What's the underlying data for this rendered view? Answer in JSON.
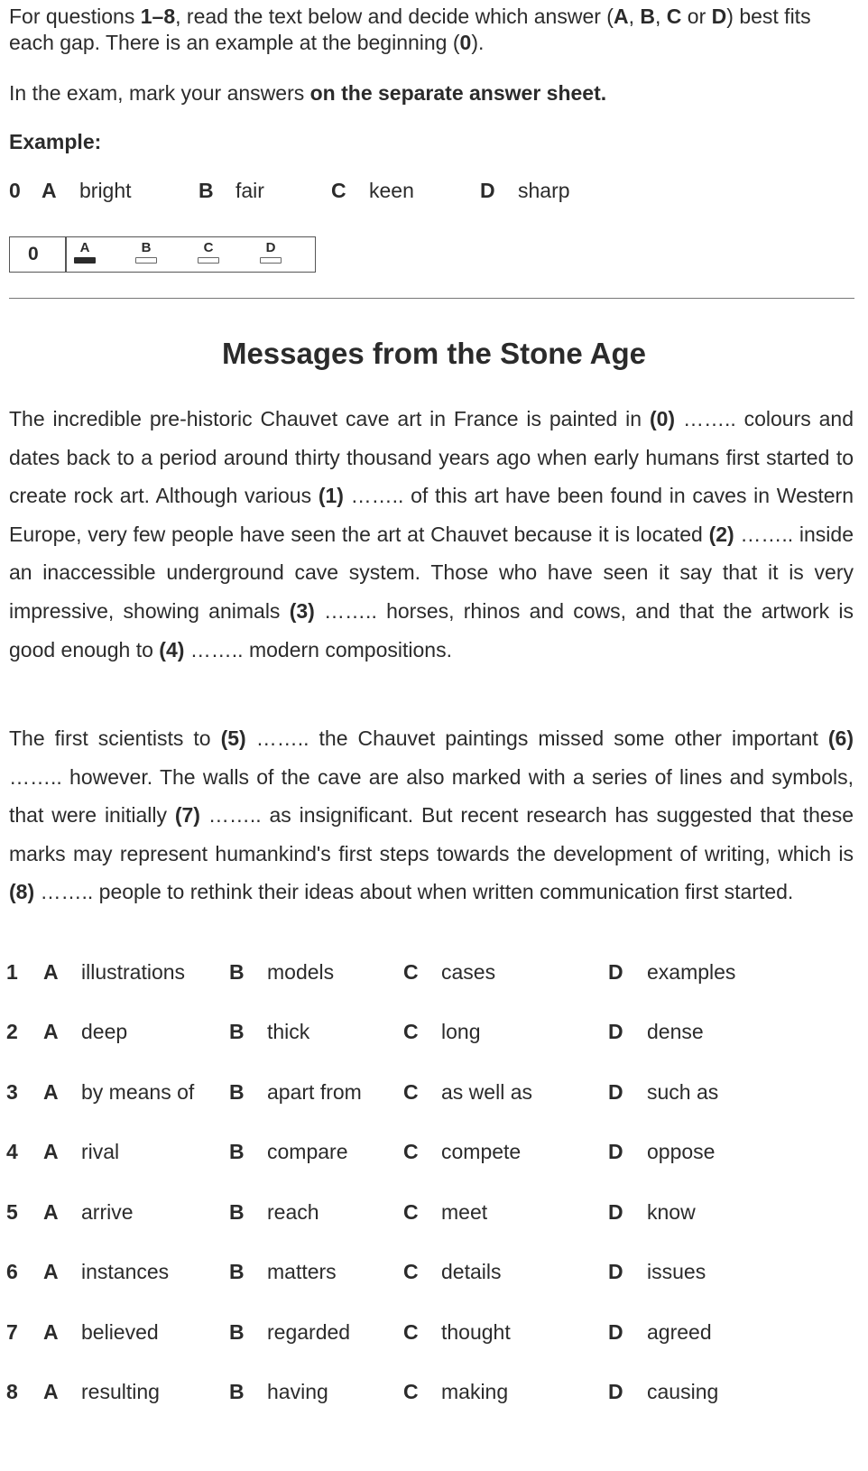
{
  "instructions": {
    "line1_a": "For questions ",
    "line1_b": "1–8",
    "line1_c": ", read the text below and decide which answer (",
    "line1_d": "A",
    "line1_e": ", ",
    "line1_f": "B",
    "line1_g": ", ",
    "line1_h": "C",
    "line1_i": " or ",
    "line1_j": "D",
    "line1_k": ") best fits each gap. There is an example at the beginning (",
    "line1_l": "0",
    "line1_m": ").",
    "line2_a": "In the exam, mark your answers ",
    "line2_b": "on the separate answer sheet."
  },
  "example": {
    "label": "Example:",
    "number": "0",
    "options": [
      {
        "letter": "A",
        "word": "bright"
      },
      {
        "letter": "B",
        "word": "fair"
      },
      {
        "letter": "C",
        "word": "keen"
      },
      {
        "letter": "D",
        "word": "sharp"
      }
    ],
    "sheet": {
      "number": "0",
      "letters": [
        "A",
        "B",
        "C",
        "D"
      ],
      "selected": "A"
    }
  },
  "title": "Messages from the Stone Age",
  "paragraph1": {
    "t0": "The incredible pre-historic Chauvet cave art in France is painted in ",
    "g0": "(0)",
    "t1": " …….. colours and dates back to a period around thirty thousand years ago when early humans first started to create rock art. Although various ",
    "g1": "(1)",
    "t2": " …….. of this art have been found in caves in Western Europe, very few people have seen the art at Chauvet because it is located ",
    "g2": "(2)",
    "t3": " …….. inside an inaccessible underground cave system. Those who have seen it say that it is very impressive, showing animals ",
    "g3": "(3)",
    "t4": " …….. horses, rhinos and cows, and that the artwork is good enough to ",
    "g4": "(4)",
    "t5": " …….. modern compositions."
  },
  "paragraph2": {
    "t0": "The first scientists to ",
    "g5": "(5)",
    "t1": " …….. the Chauvet paintings missed some other important ",
    "g6": "(6)",
    "t2": " …….. however. The walls of the cave are also marked with a series of lines and symbols, that were initially ",
    "g7": "(7)",
    "t3": " …….. as insignificant. But recent research has suggested that these marks may represent humankind's first steps towards the development of writing, which is ",
    "g8": "(8)",
    "t4": " …….. people to rethink their ideas about when written communication first started."
  },
  "questions": [
    {
      "num": "1",
      "a": "illustrations",
      "b": "models",
      "c": "cases",
      "d": "examples"
    },
    {
      "num": "2",
      "a": "deep",
      "b": "thick",
      "c": "long",
      "d": "dense"
    },
    {
      "num": "3",
      "a": "by means of",
      "b": "apart from",
      "c": "as well as",
      "d": "such as"
    },
    {
      "num": "4",
      "a": "rival",
      "b": "compare",
      "c": "compete",
      "d": "oppose"
    },
    {
      "num": "5",
      "a": "arrive",
      "b": "reach",
      "c": "meet",
      "d": "know"
    },
    {
      "num": "6",
      "a": "instances",
      "b": "matters",
      "c": "details",
      "d": "issues"
    },
    {
      "num": "7",
      "a": "believed",
      "b": "regarded",
      "c": "thought",
      "d": "agreed"
    },
    {
      "num": "8",
      "a": "resulting",
      "b": "having",
      "c": "making",
      "d": "causing"
    }
  ],
  "option_letters": {
    "a": "A",
    "b": "B",
    "c": "C",
    "d": "D"
  }
}
